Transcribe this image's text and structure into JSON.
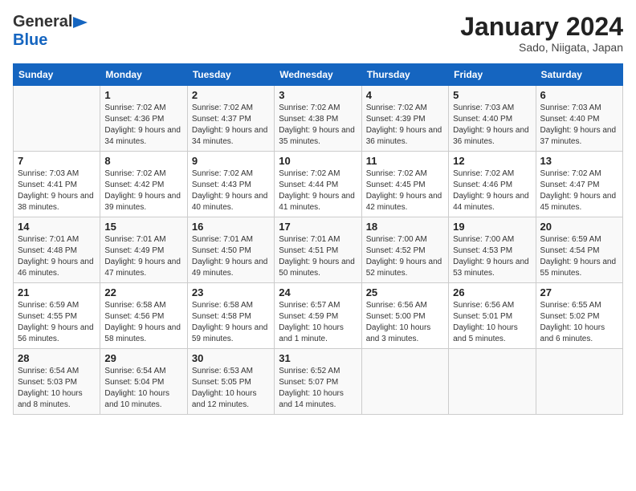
{
  "header": {
    "logo_general": "General",
    "logo_blue": "Blue",
    "title": "January 2024",
    "subtitle": "Sado, Niigata, Japan"
  },
  "days_of_week": [
    "Sunday",
    "Monday",
    "Tuesday",
    "Wednesday",
    "Thursday",
    "Friday",
    "Saturday"
  ],
  "weeks": [
    [
      {
        "day": "",
        "sunrise": "",
        "sunset": "",
        "daylight": ""
      },
      {
        "day": "1",
        "sunrise": "Sunrise: 7:02 AM",
        "sunset": "Sunset: 4:36 PM",
        "daylight": "Daylight: 9 hours and 34 minutes."
      },
      {
        "day": "2",
        "sunrise": "Sunrise: 7:02 AM",
        "sunset": "Sunset: 4:37 PM",
        "daylight": "Daylight: 9 hours and 34 minutes."
      },
      {
        "day": "3",
        "sunrise": "Sunrise: 7:02 AM",
        "sunset": "Sunset: 4:38 PM",
        "daylight": "Daylight: 9 hours and 35 minutes."
      },
      {
        "day": "4",
        "sunrise": "Sunrise: 7:02 AM",
        "sunset": "Sunset: 4:39 PM",
        "daylight": "Daylight: 9 hours and 36 minutes."
      },
      {
        "day": "5",
        "sunrise": "Sunrise: 7:03 AM",
        "sunset": "Sunset: 4:40 PM",
        "daylight": "Daylight: 9 hours and 36 minutes."
      },
      {
        "day": "6",
        "sunrise": "Sunrise: 7:03 AM",
        "sunset": "Sunset: 4:40 PM",
        "daylight": "Daylight: 9 hours and 37 minutes."
      }
    ],
    [
      {
        "day": "7",
        "sunrise": "Sunrise: 7:03 AM",
        "sunset": "Sunset: 4:41 PM",
        "daylight": "Daylight: 9 hours and 38 minutes."
      },
      {
        "day": "8",
        "sunrise": "Sunrise: 7:02 AM",
        "sunset": "Sunset: 4:42 PM",
        "daylight": "Daylight: 9 hours and 39 minutes."
      },
      {
        "day": "9",
        "sunrise": "Sunrise: 7:02 AM",
        "sunset": "Sunset: 4:43 PM",
        "daylight": "Daylight: 9 hours and 40 minutes."
      },
      {
        "day": "10",
        "sunrise": "Sunrise: 7:02 AM",
        "sunset": "Sunset: 4:44 PM",
        "daylight": "Daylight: 9 hours and 41 minutes."
      },
      {
        "day": "11",
        "sunrise": "Sunrise: 7:02 AM",
        "sunset": "Sunset: 4:45 PM",
        "daylight": "Daylight: 9 hours and 42 minutes."
      },
      {
        "day": "12",
        "sunrise": "Sunrise: 7:02 AM",
        "sunset": "Sunset: 4:46 PM",
        "daylight": "Daylight: 9 hours and 44 minutes."
      },
      {
        "day": "13",
        "sunrise": "Sunrise: 7:02 AM",
        "sunset": "Sunset: 4:47 PM",
        "daylight": "Daylight: 9 hours and 45 minutes."
      }
    ],
    [
      {
        "day": "14",
        "sunrise": "Sunrise: 7:01 AM",
        "sunset": "Sunset: 4:48 PM",
        "daylight": "Daylight: 9 hours and 46 minutes."
      },
      {
        "day": "15",
        "sunrise": "Sunrise: 7:01 AM",
        "sunset": "Sunset: 4:49 PM",
        "daylight": "Daylight: 9 hours and 47 minutes."
      },
      {
        "day": "16",
        "sunrise": "Sunrise: 7:01 AM",
        "sunset": "Sunset: 4:50 PM",
        "daylight": "Daylight: 9 hours and 49 minutes."
      },
      {
        "day": "17",
        "sunrise": "Sunrise: 7:01 AM",
        "sunset": "Sunset: 4:51 PM",
        "daylight": "Daylight: 9 hours and 50 minutes."
      },
      {
        "day": "18",
        "sunrise": "Sunrise: 7:00 AM",
        "sunset": "Sunset: 4:52 PM",
        "daylight": "Daylight: 9 hours and 52 minutes."
      },
      {
        "day": "19",
        "sunrise": "Sunrise: 7:00 AM",
        "sunset": "Sunset: 4:53 PM",
        "daylight": "Daylight: 9 hours and 53 minutes."
      },
      {
        "day": "20",
        "sunrise": "Sunrise: 6:59 AM",
        "sunset": "Sunset: 4:54 PM",
        "daylight": "Daylight: 9 hours and 55 minutes."
      }
    ],
    [
      {
        "day": "21",
        "sunrise": "Sunrise: 6:59 AM",
        "sunset": "Sunset: 4:55 PM",
        "daylight": "Daylight: 9 hours and 56 minutes."
      },
      {
        "day": "22",
        "sunrise": "Sunrise: 6:58 AM",
        "sunset": "Sunset: 4:56 PM",
        "daylight": "Daylight: 9 hours and 58 minutes."
      },
      {
        "day": "23",
        "sunrise": "Sunrise: 6:58 AM",
        "sunset": "Sunset: 4:58 PM",
        "daylight": "Daylight: 9 hours and 59 minutes."
      },
      {
        "day": "24",
        "sunrise": "Sunrise: 6:57 AM",
        "sunset": "Sunset: 4:59 PM",
        "daylight": "Daylight: 10 hours and 1 minute."
      },
      {
        "day": "25",
        "sunrise": "Sunrise: 6:56 AM",
        "sunset": "Sunset: 5:00 PM",
        "daylight": "Daylight: 10 hours and 3 minutes."
      },
      {
        "day": "26",
        "sunrise": "Sunrise: 6:56 AM",
        "sunset": "Sunset: 5:01 PM",
        "daylight": "Daylight: 10 hours and 5 minutes."
      },
      {
        "day": "27",
        "sunrise": "Sunrise: 6:55 AM",
        "sunset": "Sunset: 5:02 PM",
        "daylight": "Daylight: 10 hours and 6 minutes."
      }
    ],
    [
      {
        "day": "28",
        "sunrise": "Sunrise: 6:54 AM",
        "sunset": "Sunset: 5:03 PM",
        "daylight": "Daylight: 10 hours and 8 minutes."
      },
      {
        "day": "29",
        "sunrise": "Sunrise: 6:54 AM",
        "sunset": "Sunset: 5:04 PM",
        "daylight": "Daylight: 10 hours and 10 minutes."
      },
      {
        "day": "30",
        "sunrise": "Sunrise: 6:53 AM",
        "sunset": "Sunset: 5:05 PM",
        "daylight": "Daylight: 10 hours and 12 minutes."
      },
      {
        "day": "31",
        "sunrise": "Sunrise: 6:52 AM",
        "sunset": "Sunset: 5:07 PM",
        "daylight": "Daylight: 10 hours and 14 minutes."
      },
      {
        "day": "",
        "sunrise": "",
        "sunset": "",
        "daylight": ""
      },
      {
        "day": "",
        "sunrise": "",
        "sunset": "",
        "daylight": ""
      },
      {
        "day": "",
        "sunrise": "",
        "sunset": "",
        "daylight": ""
      }
    ]
  ]
}
